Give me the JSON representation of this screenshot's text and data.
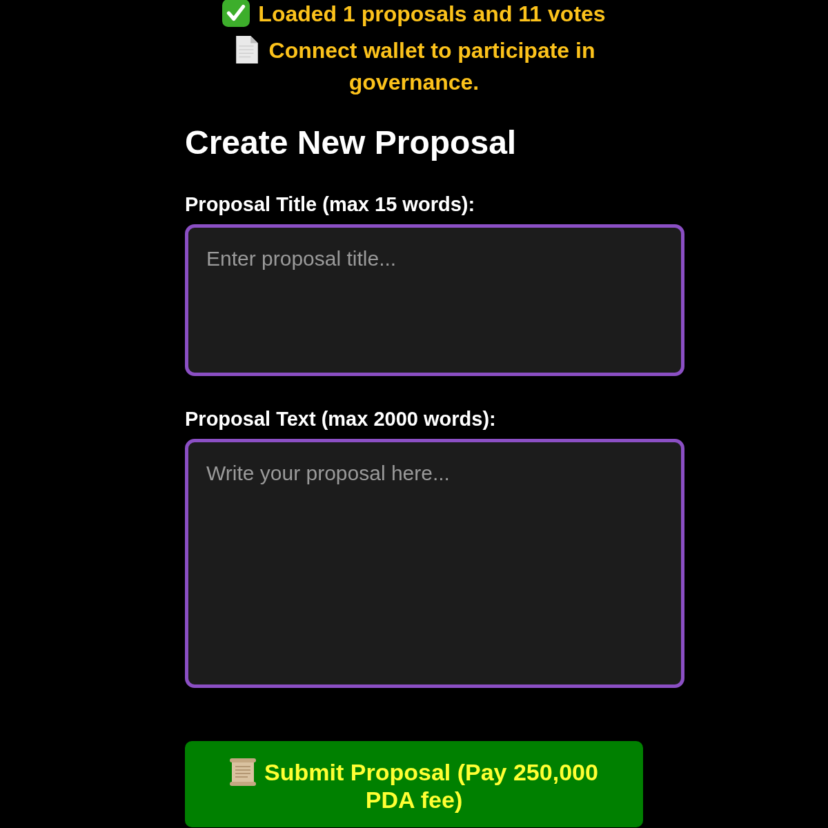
{
  "status_messages": [
    {
      "kind": "success",
      "text": "Loaded 1 proposals and 11 votes"
    },
    {
      "kind": "info",
      "text": "Connect wallet to participate in governance."
    }
  ],
  "form": {
    "title": "Create New Proposal",
    "fields": [
      {
        "label": "Proposal Title (max 15 words):",
        "placeholder": "Enter proposal title..."
      },
      {
        "label": "Proposal Text (max 2000 words):",
        "placeholder": "Write your proposal here..."
      }
    ],
    "submit_button": {
      "label": "Submit Proposal (Pay 250,000 PDA fee)"
    }
  }
}
